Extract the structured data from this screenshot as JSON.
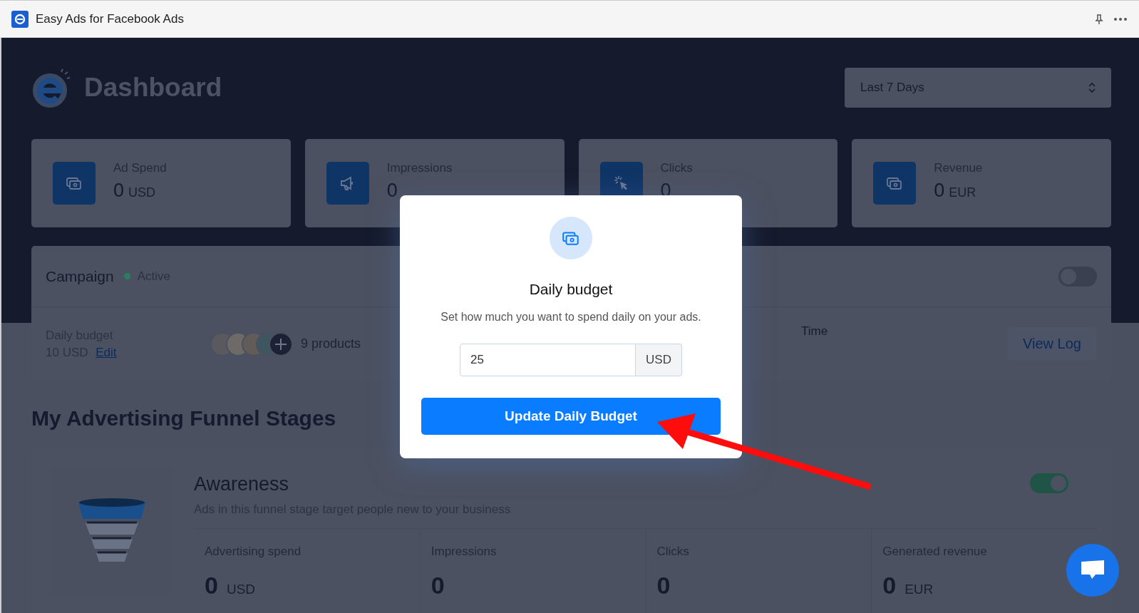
{
  "window": {
    "title": "Easy Ads for Facebook Ads"
  },
  "header": {
    "title": "Dashboard",
    "date_range": "Last 7 Days"
  },
  "stats": [
    {
      "kind": "money",
      "label": "Ad Spend",
      "value": "0",
      "unit": "USD"
    },
    {
      "kind": "megaphone",
      "label": "Impressions",
      "value": "0"
    },
    {
      "kind": "cursor",
      "label": "Clicks",
      "value": "0"
    },
    {
      "kind": "money",
      "label": "Revenue",
      "value": "0",
      "unit": "EUR"
    }
  ],
  "campaign": {
    "title": "Campaign",
    "status": "Active",
    "on": false,
    "budget_label": "Daily budget",
    "budget_value": "10 USD",
    "edit_link": "Edit",
    "products": "9 products",
    "time_label": "Time",
    "view_log": "View Log"
  },
  "funnel": {
    "title": "My Advertising Funnel Stages",
    "stages": [
      {
        "name": "Awareness",
        "description": "Ads in this funnel stage target people new to your business",
        "on": true,
        "metrics": [
          {
            "label": "Advertising spend",
            "value": "0",
            "unit": "USD"
          },
          {
            "label": "Impressions",
            "value": "0"
          },
          {
            "label": "Clicks",
            "value": "0"
          },
          {
            "label": "Generated revenue",
            "value": "0",
            "unit": "EUR"
          }
        ]
      }
    ]
  },
  "modal": {
    "title": "Daily budget",
    "text": "Set how much you want to spend daily on your ads.",
    "amount": "25",
    "currency": "USD",
    "button": "Update Daily Budget"
  }
}
